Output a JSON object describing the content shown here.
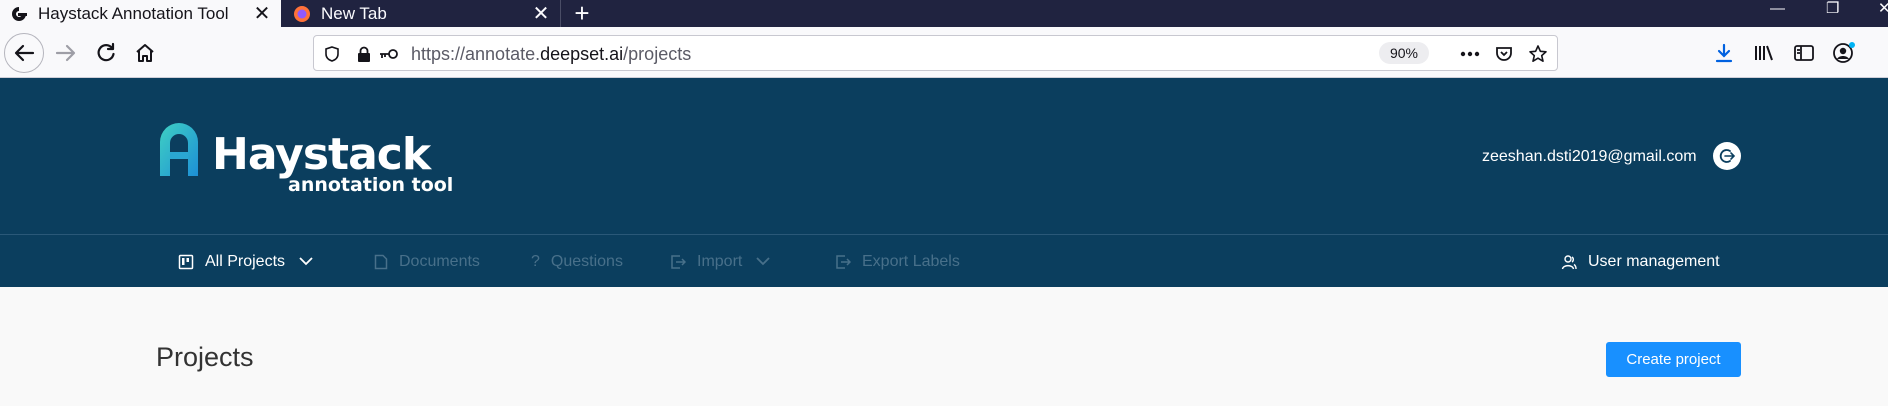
{
  "browser": {
    "tabs": [
      {
        "label": "Haystack Annotation Tool",
        "active": true,
        "favicon": "haystack-logo-icon"
      },
      {
        "label": "New Tab",
        "active": false,
        "favicon": "firefox-icon"
      }
    ],
    "url": {
      "scheme_prefix": "https://annotate.",
      "domain": "deepset.ai",
      "path": "/projects"
    },
    "zoom": "90%"
  },
  "app": {
    "brand": {
      "name": "Haystack",
      "subtitle": "annotation tool"
    },
    "user_email": "zeeshan.dsti2019@gmail.com",
    "nav": {
      "all_projects": "All Projects",
      "documents": "Documents",
      "questions": "Questions",
      "import": "Import",
      "export_labels": "Export Labels",
      "user_management": "User management"
    },
    "page_title": "Projects",
    "create_project_label": "Create project"
  },
  "colors": {
    "header_bg": "#0b3e5e",
    "primary_button": "#1890ff",
    "nav_disabled": "#48708a",
    "tabstrip_bg": "#202340"
  }
}
